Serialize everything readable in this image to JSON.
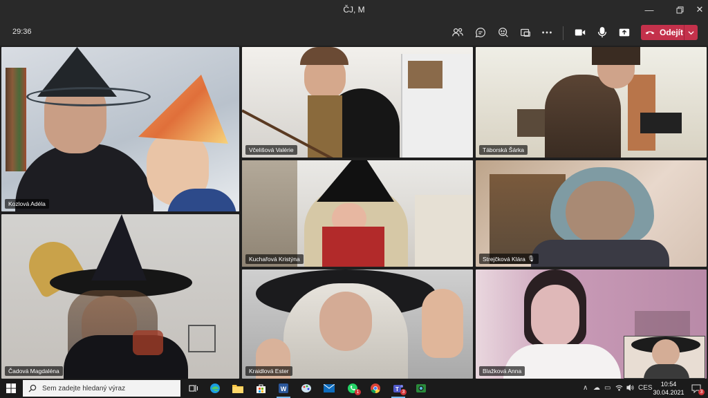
{
  "window": {
    "title": "ČJ, M"
  },
  "toolbar": {
    "timer": "29:36",
    "leave_label": "Odejít"
  },
  "participants": [
    {
      "name": "Kozlová Adéla"
    },
    {
      "name": "Včelišová Valérie"
    },
    {
      "name": "Táborská Šárka"
    },
    {
      "name": "Kuchařová Kristýna"
    },
    {
      "name": "Strejčková Klára"
    },
    {
      "name": "Čadová Magdaléna"
    },
    {
      "name": "Kraidlová Ester"
    },
    {
      "name": "Blažková Anna"
    }
  ],
  "taskbar": {
    "search_placeholder": "Sem zadejte hledaný výraz",
    "language": "CES",
    "time": "10:54",
    "date": "30.04.2021",
    "notification_count": "3",
    "whatsapp_badge": "1",
    "teams_badge": "3"
  },
  "colors": {
    "leave": "#c4314b",
    "titlebar": "#292929",
    "taskbar": "#1b1b1b"
  }
}
